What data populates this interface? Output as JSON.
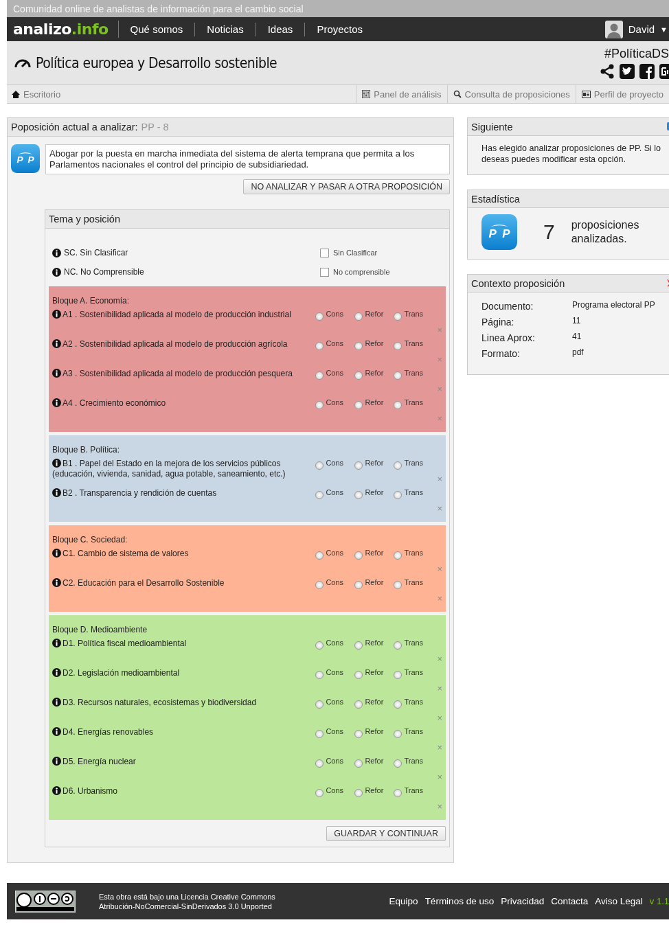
{
  "top_bar": {
    "tagline": "Comunidad online de analistas de información para el cambio social"
  },
  "nav": {
    "logo_main": "analizo",
    "logo_accent": ".info",
    "links": [
      "Qué somos",
      "Noticias",
      "Ideas",
      "Proyectos"
    ],
    "user": "David",
    "caret": "▼"
  },
  "header": {
    "title": "Política europea y Desarrollo sostenible",
    "hashtag": "#PolíticaDS"
  },
  "toolbar": {
    "home": "Escritorio",
    "links": [
      {
        "label": "Panel de análisis",
        "kind": "panel"
      },
      {
        "label": "Consulta de proposiciones",
        "kind": "search"
      },
      {
        "label": "Perfil de proyecto",
        "kind": "profile"
      }
    ]
  },
  "proposition": {
    "logo": "PP",
    "label": "Poposición actual a analizar:",
    "code": "PP - 8",
    "text": "Abogar por la puesta en marcha inmediata del sistema de alerta temprana que permita a los Parlamentos nacionales el control del principio de subsidiariedad.",
    "skip_button": "NO ANALIZAR Y PASAR A OTRA PROPOSICIÓN"
  },
  "classification": {
    "title": "Tema y posición",
    "special": [
      {
        "label": "SC. Sin Clasificar",
        "option": "Sin Clasificar",
        "checked": false
      },
      {
        "label": "NC. No Comprensible",
        "option": "No comprensible",
        "checked": false
      }
    ],
    "blocks": [
      {
        "title": "Bloque A. Economía:",
        "color": "#e49797",
        "items": [
          {
            "label": "A1 . Sostenibilidad aplicada al modelo de producción industrial",
            "options": [
              {
                "label": "Cons",
                "selected": false
              },
              {
                "label": "Refor",
                "selected": false
              },
              {
                "label": "Trans",
                "selected": false
              }
            ],
            "clear": "×"
          },
          {
            "label": "A2 . Sostenibilidad aplicada al modelo de producción agrícola",
            "options": [
              {
                "label": "Cons",
                "selected": false
              },
              {
                "label": "Refor",
                "selected": false
              },
              {
                "label": "Trans",
                "selected": false
              }
            ],
            "clear": "×"
          },
          {
            "label": "A3 . Sostenibilidad aplicada al modelo de producción pesquera",
            "options": [
              {
                "label": "Cons",
                "selected": false
              },
              {
                "label": "Refor",
                "selected": false
              },
              {
                "label": "Trans",
                "selected": false
              }
            ],
            "clear": "×"
          },
          {
            "label": "A4 . Crecimiento económico",
            "options": [
              {
                "label": "Cons",
                "selected": false
              },
              {
                "label": "Refor",
                "selected": false
              },
              {
                "label": "Trans",
                "selected": false
              }
            ],
            "clear": "×"
          }
        ]
      },
      {
        "title": "Bloque B. Política:",
        "color": "#c9d6e3",
        "items": [
          {
            "label": "B1 . Papel del Estado en la mejora de los servicios públicos (educación, vivienda, sanidad, agua potable, saneamiento, etc.)",
            "options": [
              {
                "label": "Cons",
                "selected": false
              },
              {
                "label": "Refor",
                "selected": false
              },
              {
                "label": "Trans",
                "selected": false
              }
            ],
            "clear": "×"
          },
          {
            "label": "B2 . Transparencia y rendición de cuentas",
            "options": [
              {
                "label": "Cons",
                "selected": false
              },
              {
                "label": "Refor",
                "selected": false
              },
              {
                "label": "Trans",
                "selected": false
              }
            ],
            "clear": "×"
          }
        ]
      },
      {
        "title": "Bloque C. Sociedad:",
        "color": "#fdb394",
        "items": [
          {
            "label": "C1. Cambio de sistema de valores",
            "options": [
              {
                "label": "Cons",
                "selected": false
              },
              {
                "label": "Refor",
                "selected": false
              },
              {
                "label": "Trans",
                "selected": false
              }
            ],
            "clear": "×"
          },
          {
            "label": "C2. Educación para el Desarrollo Sostenible",
            "options": [
              {
                "label": "Cons",
                "selected": false
              },
              {
                "label": "Refor",
                "selected": false
              },
              {
                "label": "Trans",
                "selected": false
              }
            ],
            "clear": "×"
          }
        ]
      },
      {
        "title": "Bloque D. Medioambiente",
        "color": "#bce69a",
        "items": [
          {
            "label": "D1. Política fiscal medioambiental",
            "options": [
              {
                "label": "Cons",
                "selected": false
              },
              {
                "label": "Refor",
                "selected": false
              },
              {
                "label": "Trans",
                "selected": false
              }
            ],
            "clear": "×"
          },
          {
            "label": "D2. Legislación medioambiental",
            "options": [
              {
                "label": "Cons",
                "selected": false
              },
              {
                "label": "Refor",
                "selected": false
              },
              {
                "label": "Trans",
                "selected": false
              }
            ],
            "clear": "×"
          },
          {
            "label": "D3. Recursos naturales, ecosistemas y biodiversidad",
            "options": [
              {
                "label": "Cons",
                "selected": false
              },
              {
                "label": "Refor",
                "selected": false
              },
              {
                "label": "Trans",
                "selected": false
              }
            ],
            "clear": "×"
          },
          {
            "label": "D4. Energías renovables",
            "options": [
              {
                "label": "Cons",
                "selected": false
              },
              {
                "label": "Refor",
                "selected": false
              },
              {
                "label": "Trans",
                "selected": false
              }
            ],
            "clear": "×"
          },
          {
            "label": "D5. Energía nuclear",
            "options": [
              {
                "label": "Cons",
                "selected": false
              },
              {
                "label": "Refor",
                "selected": false
              },
              {
                "label": "Trans",
                "selected": false
              }
            ],
            "clear": "×"
          },
          {
            "label": "D6. Urbanismo",
            "options": [
              {
                "label": "Cons",
                "selected": false
              },
              {
                "label": "Refor",
                "selected": false
              },
              {
                "label": "Trans",
                "selected": false
              }
            ],
            "clear": "×"
          }
        ]
      }
    ],
    "save_button": "GUARDAR Y CONTINUAR"
  },
  "sidebar": {
    "next": {
      "title": "Siguiente",
      "text": "Has elegido analizar proposiciones de PP. Si lo deseas puedes modificar esta opción."
    },
    "stats": {
      "logo": "PP",
      "title": "Estadística",
      "count": "7",
      "text": "proposiciones analizadas."
    },
    "context": {
      "title": "Contexto proposición",
      "fields": [
        {
          "label": "Documento:",
          "value": "Programa electoral PP"
        },
        {
          "label": "Página:",
          "value": "11"
        },
        {
          "label": "Linea Aprox:",
          "value": "41"
        },
        {
          "label": "Formato:",
          "value": "pdf"
        }
      ]
    }
  },
  "footer": {
    "license_lines": [
      "Esta obra está bajo una Licencia Creative Commons",
      "Atribución-NoComercial-SinDerivados 3.0 Unported"
    ],
    "links": [
      "Equipo",
      "Términos de uso",
      "Privacidad",
      "Contacta",
      "Aviso Legal"
    ],
    "version": "v 1.1"
  }
}
